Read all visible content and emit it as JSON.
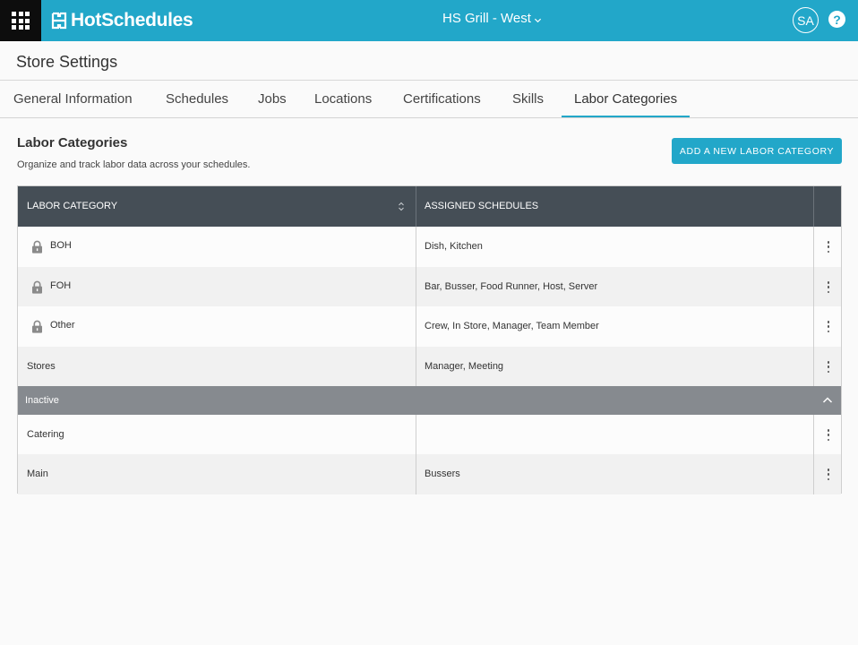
{
  "header": {
    "logo_text": "HotSchedules",
    "store_name": "HS Grill - West",
    "user_initials": "SA",
    "help_label": "?",
    "brand_color": "#22a7c9"
  },
  "page": {
    "title": "Store Settings"
  },
  "tabs": [
    {
      "label": "General Information"
    },
    {
      "label": "Schedules"
    },
    {
      "label": "Jobs"
    },
    {
      "label": "Locations"
    },
    {
      "label": "Certifications"
    },
    {
      "label": "Skills"
    },
    {
      "label": "Labor Categories",
      "active": true
    }
  ],
  "section": {
    "title": "Labor Categories",
    "subtitle": "Organize and track labor data across your schedules.",
    "add_button_label": "ADD A NEW LABOR CATEGORY"
  },
  "table": {
    "columns": [
      "LABOR CATEGORY",
      "ASSIGNED SCHEDULES"
    ],
    "active_rows": [
      {
        "category": "BOH",
        "schedules": "Dish, Kitchen",
        "locked": true
      },
      {
        "category": "FOH",
        "schedules": "Bar, Busser, Food Runner, Host, Server",
        "locked": true
      },
      {
        "category": "Other",
        "schedules": "Crew, In Store, Manager, Team Member",
        "locked": true
      },
      {
        "category": "Stores",
        "schedules": "Manager, Meeting",
        "locked": false
      }
    ],
    "inactive_group_label": "Inactive",
    "inactive_rows": [
      {
        "category": "Catering",
        "schedules": ""
      },
      {
        "category": "Main",
        "schedules": "Bussers"
      }
    ]
  }
}
